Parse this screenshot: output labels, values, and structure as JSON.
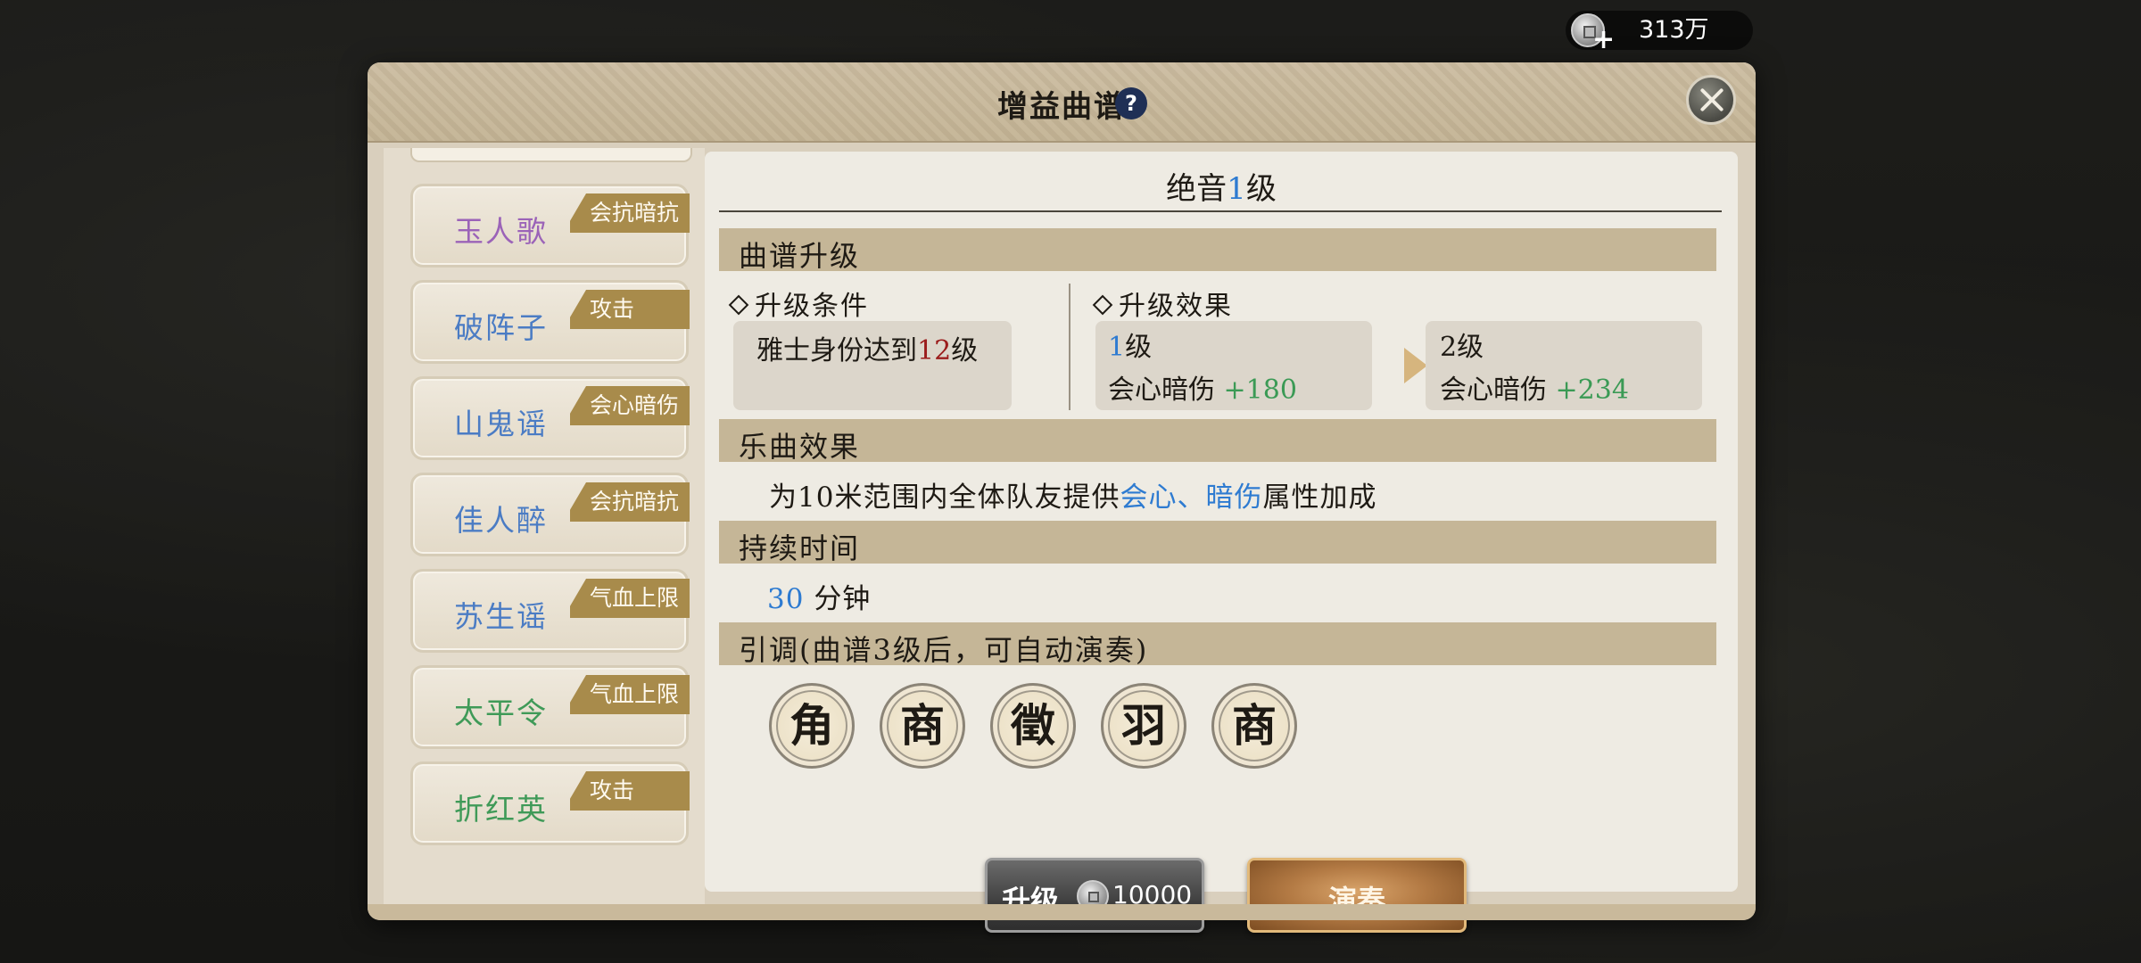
{
  "currency": {
    "amount": "313万",
    "icon": "coin-plus-icon"
  },
  "dialog": {
    "title": "增益曲谱",
    "help": "?"
  },
  "songs": [
    {
      "name": "玉人歌",
      "tag": "会抗暗抗",
      "color": "#9b63b8"
    },
    {
      "name": "破阵子",
      "tag": "攻击",
      "color": "#4b7cc4"
    },
    {
      "name": "山鬼谣",
      "tag": "会心暗伤",
      "color": "#4b7cc4"
    },
    {
      "name": "佳人醉",
      "tag": "会抗暗抗",
      "color": "#4b7cc4"
    },
    {
      "name": "苏生谣",
      "tag": "气血上限",
      "color": "#4b7cc4"
    },
    {
      "name": "太平令",
      "tag": "气血上限",
      "color": "#3f9a58"
    },
    {
      "name": "折红英",
      "tag": "攻击",
      "color": "#3f9a58"
    }
  ],
  "detail": {
    "title_pre": "绝音",
    "title_level": "1",
    "title_post": "级",
    "upgrade_section": "曲谱升级",
    "condition_label": "升级条件",
    "condition_pre": "雅士身份达到",
    "condition_level": "12",
    "condition_post": "级",
    "effect_label": "升级效果",
    "current_level": "1",
    "current_level_suffix": "级",
    "current_stat": "会心暗伤",
    "current_value": "+180",
    "next_level": "2级",
    "next_stat": "会心暗伤",
    "next_value": "+234",
    "music_section": "乐曲效果",
    "music_pre": "为10米范围内全体队友提供",
    "music_highlight": "会心、暗伤",
    "music_post": "属性加成",
    "duration_section": "持续时间",
    "duration_value": "30",
    "duration_unit": "分钟",
    "tune_section": "引调(曲谱3级后，可自动演奏)",
    "tones": [
      "角",
      "商",
      "徵",
      "羽",
      "商"
    ]
  },
  "buttons": {
    "upgrade_label": "升级",
    "upgrade_cost": "10000",
    "play_label": "演奏"
  },
  "colors": {
    "accent_blue": "#2e7bd1",
    "accent_red": "#9b1c1c",
    "accent_green": "#3b9a55",
    "tag_gold": "#a88b4b"
  }
}
